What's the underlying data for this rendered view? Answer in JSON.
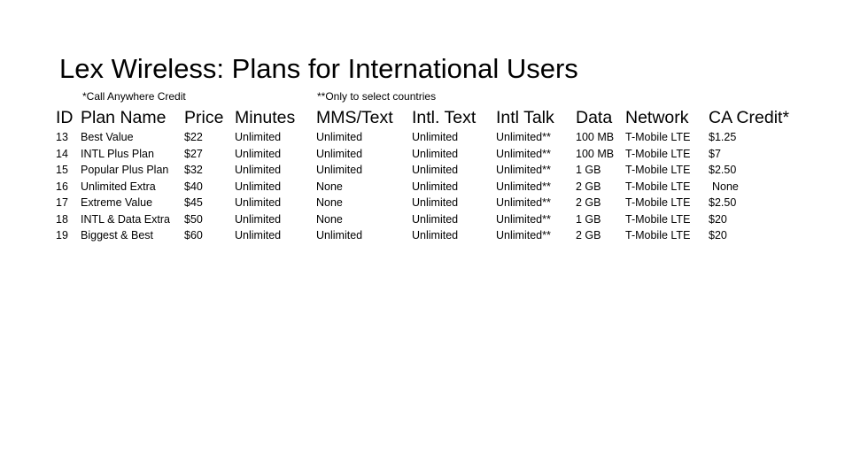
{
  "title": "Lex Wireless: Plans for International Users",
  "footnotes": {
    "call_anywhere": "*Call Anywhere Credit",
    "select_countries": "**Only to select countries"
  },
  "table": {
    "headers": [
      "ID",
      "Plan Name",
      "Price",
      "Minutes",
      "MMS/Text",
      "Intl. Text",
      "Intl Talk",
      "Data",
      "Network",
      "CA Credit*"
    ],
    "rows": [
      {
        "id": "13",
        "name": "Best Value",
        "price": "$22",
        "minutes": "Unlimited",
        "mms": "Unlimited",
        "intl_text": "Unlimited",
        "intl_talk": "Unlimited**",
        "data": "100 MB",
        "network": "T-Mobile LTE",
        "credit": "$1.25"
      },
      {
        "id": "14",
        "name": "INTL Plus Plan",
        "price": "$27",
        "minutes": "Unlimited",
        "mms": "Unlimited",
        "intl_text": "Unlimited",
        "intl_talk": "Unlimited**",
        "data": "100 MB",
        "network": "T-Mobile LTE",
        "credit": "$7"
      },
      {
        "id": "15",
        "name": "Popular Plus Plan",
        "price": "$32",
        "minutes": "Unlimited",
        "mms": "Unlimited",
        "intl_text": "Unlimited",
        "intl_talk": "Unlimited**",
        "data": "1 GB",
        "network": "T-Mobile LTE",
        "credit": "$2.50"
      },
      {
        "id": "16",
        "name": "Unlimited Extra",
        "price": "$40",
        "minutes": "Unlimited",
        "mms": "None",
        "intl_text": "Unlimited",
        "intl_talk": "Unlimited**",
        "data": "2 GB",
        "network": "T-Mobile LTE",
        "credit": "None"
      },
      {
        "id": "17",
        "name": "Extreme Value",
        "price": "$45",
        "minutes": "Unlimited",
        "mms": "None",
        "intl_text": "Unlimited",
        "intl_talk": "Unlimited**",
        "data": "2 GB",
        "network": "T-Mobile LTE",
        "credit": "$2.50"
      },
      {
        "id": "18",
        "name": "INTL & Data Extra",
        "price": "$50",
        "minutes": "Unlimited",
        "mms": "None",
        "intl_text": "Unlimited",
        "intl_talk": "Unlimited**",
        "data": "1 GB",
        "network": "T-Mobile LTE",
        "credit": "$20"
      },
      {
        "id": "19",
        "name": "Biggest & Best",
        "price": "$60",
        "minutes": "Unlimited",
        "mms": "Unlimited",
        "intl_text": "Unlimited",
        "intl_talk": "Unlimited**",
        "data": "2 GB",
        "network": "T-Mobile LTE",
        "credit": "$20"
      }
    ]
  }
}
